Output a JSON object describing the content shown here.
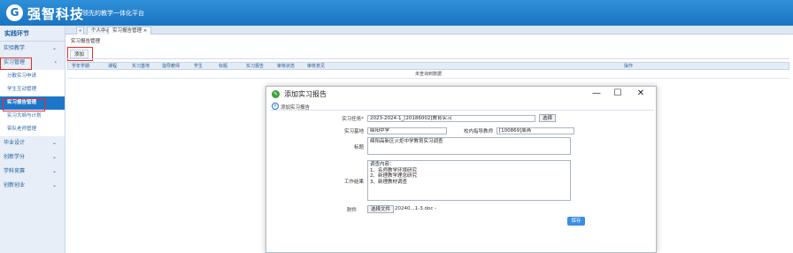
{
  "header": {
    "logo_glyph": "G",
    "brand": "强智科技",
    "slogan": "领先的教学一体化平台"
  },
  "sidebar": {
    "title": "实践环节",
    "groups": [
      {
        "label": "实验教学",
        "chevron": "⌄"
      },
      {
        "label": "实习管理",
        "chevron": "‹"
      },
      {
        "label": "毕业设计",
        "chevron": "⌄"
      },
      {
        "label": "创新学分",
        "chevron": "⌄"
      },
      {
        "label": "学科竞赛",
        "chevron": "⌄"
      },
      {
        "label": "创新创业",
        "chevron": "⌄"
      }
    ],
    "subitems": [
      "分散实习申请",
      "学生互动管理",
      "实习报告管理",
      "实习大纲与计划",
      "带队老师管理"
    ]
  },
  "tabs": {
    "collapse": "«",
    "home": "个人中心",
    "current": "实习报告管理",
    "close": "×"
  },
  "breadcrumb": "实习报告管理",
  "toolbar": {
    "add_label": "添加"
  },
  "grid": {
    "headers": [
      "学年学期",
      "课程",
      "实习基地",
      "指导教师",
      "学生",
      "标题",
      "实习报告",
      "审核状态",
      "审核意见",
      "操作"
    ],
    "empty_text": "未查询到数据"
  },
  "dialog": {
    "title": "添加实习报告",
    "inner_title": "添加实习报告",
    "minimize": "—",
    "maximize": "☐",
    "close": "✕",
    "fields": {
      "task_label": "实习任务*",
      "task_value": "2023-2024-1_[20186002]教育实习",
      "select_label": "选择",
      "base_label": "实习基地",
      "base_value": "绵阳中学",
      "teacher_label": "校内指导教师",
      "teacher_value": "[100869]周燕",
      "title_label": "标题",
      "title_value": "绵阳高新区火炬中学教育实习调查",
      "work_label": "工作结果",
      "work_value": "调查内容：\n1、名师教学环境研究\n2、新理教学理念研究\n3、新理教材调查",
      "attach_label": "附件",
      "file_button": "选择文件",
      "file_name": "20240...1-3.doc -"
    },
    "save_label": "保存"
  },
  "colors": {
    "header": "#1a74c2",
    "active": "#1e76c8",
    "highlight": "#e52a2a",
    "save": "#3a8ee6"
  }
}
